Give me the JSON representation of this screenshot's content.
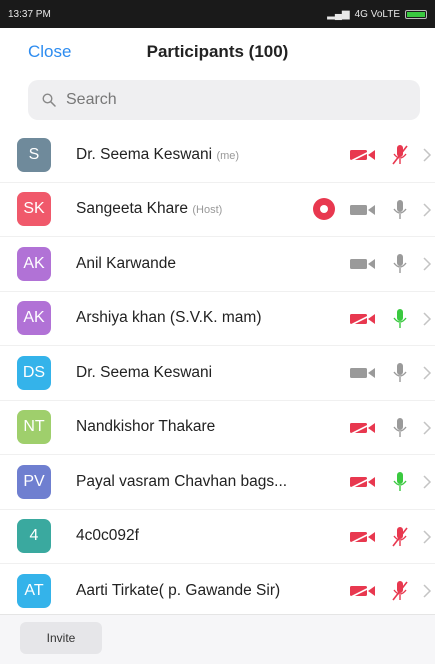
{
  "status_bar": {
    "time": "13:37 PM",
    "network": "4G VoLTE"
  },
  "header": {
    "close_label": "Close",
    "title": "Participants (100)"
  },
  "search": {
    "placeholder": "Search"
  },
  "participants": [
    {
      "initials": "S",
      "name": "Dr. Seema Keswani",
      "role": "(me)",
      "avatar_color": "#6f8a9b",
      "recording": false,
      "video": "off",
      "audio": "muted"
    },
    {
      "initials": "SK",
      "name": "Sangeeta Khare",
      "role": "(Host)",
      "avatar_color": "#f0596b",
      "recording": true,
      "video": "on",
      "audio": "on"
    },
    {
      "initials": "AK",
      "name": "Anil Karwande",
      "role": "",
      "avatar_color": "#b172d6",
      "recording": false,
      "video": "on",
      "audio": "on"
    },
    {
      "initials": "AK",
      "name": "Arshiya khan (S.V.K. mam)",
      "role": "",
      "avatar_color": "#b172d6",
      "recording": false,
      "video": "off",
      "audio": "speaking"
    },
    {
      "initials": "DS",
      "name": "Dr. Seema Keswani",
      "role": "",
      "avatar_color": "#34b3ea",
      "recording": false,
      "video": "on",
      "audio": "on"
    },
    {
      "initials": "NT",
      "name": "Nandkishor Thakare",
      "role": "",
      "avatar_color": "#9fcf6c",
      "recording": false,
      "video": "off",
      "audio": "on"
    },
    {
      "initials": "PV",
      "name": "Payal vasram Chavhan bags...",
      "role": "",
      "avatar_color": "#6f7fd0",
      "recording": false,
      "video": "off",
      "audio": "speaking"
    },
    {
      "initials": "4",
      "name": "4c0c092f",
      "role": "",
      "avatar_color": "#3aa99f",
      "recording": false,
      "video": "off",
      "audio": "muted"
    },
    {
      "initials": "AT",
      "name": "Aarti Tirkate( p. Gawande Sir)",
      "role": "",
      "avatar_color": "#34b3ea",
      "recording": false,
      "video": "off",
      "audio": "muted"
    }
  ],
  "colors": {
    "accent": "#2d8cf0",
    "muted_red": "#e8384f",
    "speaking_green": "#3ac940",
    "idle_gray": "#9a9a9a"
  },
  "footer": {
    "invite_label": "Invite"
  }
}
